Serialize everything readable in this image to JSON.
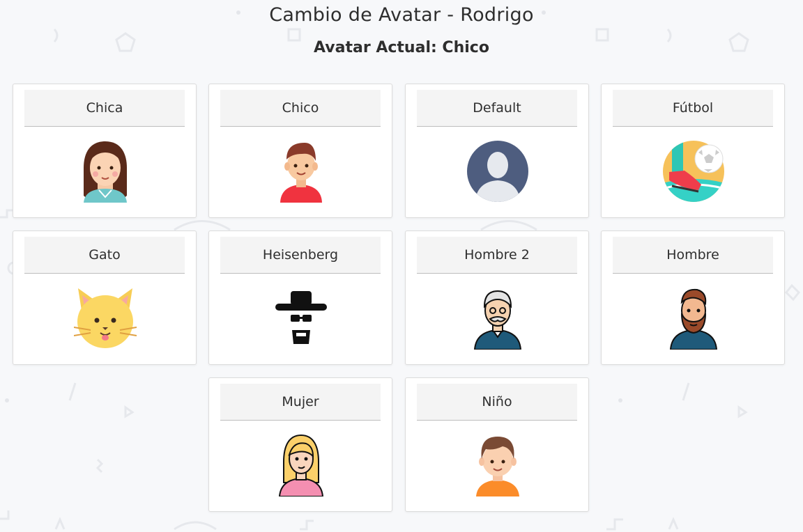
{
  "header": {
    "title": "Cambio de Avatar - Rodrigo",
    "subtitle": "Avatar Actual: Chico"
  },
  "avatars": [
    {
      "label": "Chica",
      "icon": "girl-avatar-icon"
    },
    {
      "label": "Chico",
      "icon": "boy-avatar-icon"
    },
    {
      "label": "Default",
      "icon": "default-user-icon"
    },
    {
      "label": "Fútbol",
      "icon": "soccer-icon"
    },
    {
      "label": "Gato",
      "icon": "cat-icon"
    },
    {
      "label": "Heisenberg",
      "icon": "heisenberg-icon"
    },
    {
      "label": "Hombre 2",
      "icon": "old-man-icon"
    },
    {
      "label": "Hombre",
      "icon": "bearded-man-icon"
    },
    {
      "label": "Mujer",
      "icon": "woman-icon"
    },
    {
      "label": "Niño",
      "icon": "kid-icon"
    }
  ],
  "colors": {
    "background": "#f7f8fa",
    "card_border": "#dcdcdc",
    "card_header": "#f4f4f4"
  }
}
